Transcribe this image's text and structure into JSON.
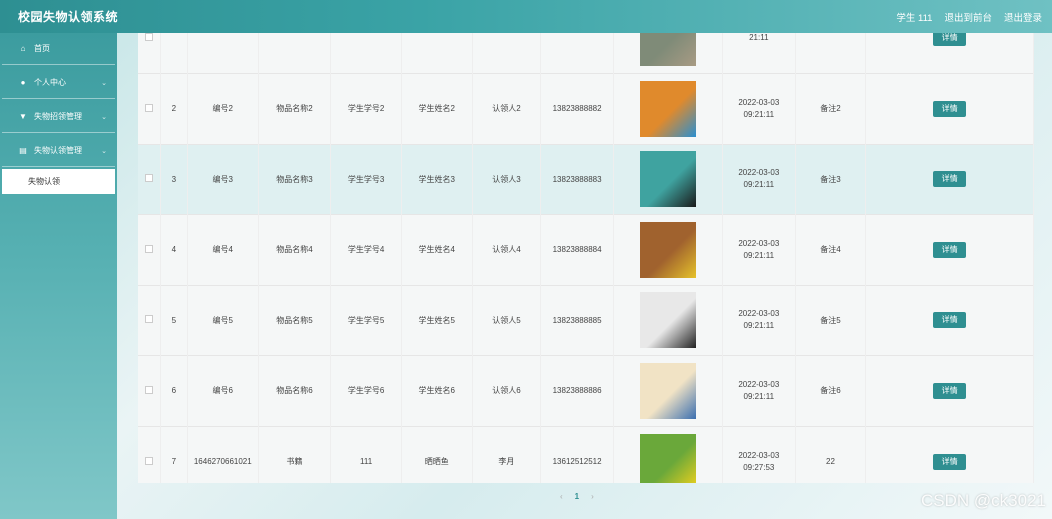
{
  "app_title": "校园失物认领系统",
  "header": {
    "user": "学生 111",
    "back": "退出到前台",
    "logout": "退出登录"
  },
  "sidebar": [
    {
      "icon": "home-icon",
      "glyph": "⌂",
      "label": "首页",
      "expandable": false
    },
    {
      "icon": "user-icon",
      "glyph": "●",
      "label": "个人中心",
      "expandable": true
    },
    {
      "icon": "filter-icon",
      "glyph": "▼",
      "label": "失物招领管理",
      "expandable": true
    },
    {
      "icon": "list-icon",
      "glyph": "▤",
      "label": "失物认领管理",
      "expandable": true
    }
  ],
  "submenu_label": "失物认领",
  "table": {
    "rows": [
      {
        "idx": "",
        "code": "",
        "name": "",
        "sid": "",
        "sname": "",
        "claimant": "",
        "phone": "",
        "date": "21:11",
        "note": "",
        "img": "thumb-1",
        "colors": [
          "#7f8b78",
          "#a89b84"
        ]
      },
      {
        "idx": "2",
        "code": "编号2",
        "name": "物品名称2",
        "sid": "学生学号2",
        "sname": "学生姓名2",
        "claimant": "认领人2",
        "phone": "13823888882",
        "date": "2022-03-03 09:21:11",
        "note": "备注2",
        "img": "thumb-2",
        "colors": [
          "#e08a2c",
          "#2a8fd0"
        ]
      },
      {
        "idx": "3",
        "code": "编号3",
        "name": "物品名称3",
        "sid": "学生学号3",
        "sname": "学生姓名3",
        "claimant": "认领人3",
        "phone": "13823888883",
        "date": "2022-03-03 09:21:11",
        "note": "备注3",
        "img": "thumb-3",
        "colors": [
          "#3fa3a0",
          "#1a1a1a"
        ]
      },
      {
        "idx": "4",
        "code": "编号4",
        "name": "物品名称4",
        "sid": "学生学号4",
        "sname": "学生姓名4",
        "claimant": "认领人4",
        "phone": "13823888884",
        "date": "2022-03-03 09:21:11",
        "note": "备注4",
        "img": "thumb-4",
        "colors": [
          "#a0622e",
          "#e6c22a"
        ]
      },
      {
        "idx": "5",
        "code": "编号5",
        "name": "物品名称5",
        "sid": "学生学号5",
        "sname": "学生姓名5",
        "claimant": "认领人5",
        "phone": "13823888885",
        "date": "2022-03-03 09:21:11",
        "note": "备注5",
        "img": "thumb-5",
        "colors": [
          "#e8e8e8",
          "#222222"
        ]
      },
      {
        "idx": "6",
        "code": "编号6",
        "name": "物品名称6",
        "sid": "学生学号6",
        "sname": "学生姓名6",
        "claimant": "认领人6",
        "phone": "13823888886",
        "date": "2022-03-03 09:21:11",
        "note": "备注6",
        "img": "thumb-6",
        "colors": [
          "#f1e3c5",
          "#3b6fb0"
        ]
      },
      {
        "idx": "7",
        "code": "1646270661021",
        "name": "书籍",
        "sid": "111",
        "sname": "晒晒鱼",
        "claimant": "李月",
        "phone": "13612512512",
        "date": "2022-03-03 09:27:53",
        "note": "22",
        "img": "thumb-7",
        "colors": [
          "#6aa83a",
          "#f2d21c"
        ]
      }
    ],
    "detail_label": "详情"
  },
  "pager": {
    "prev": "‹",
    "page": "1",
    "next": "›"
  },
  "watermark": "CSDN @ck3021"
}
